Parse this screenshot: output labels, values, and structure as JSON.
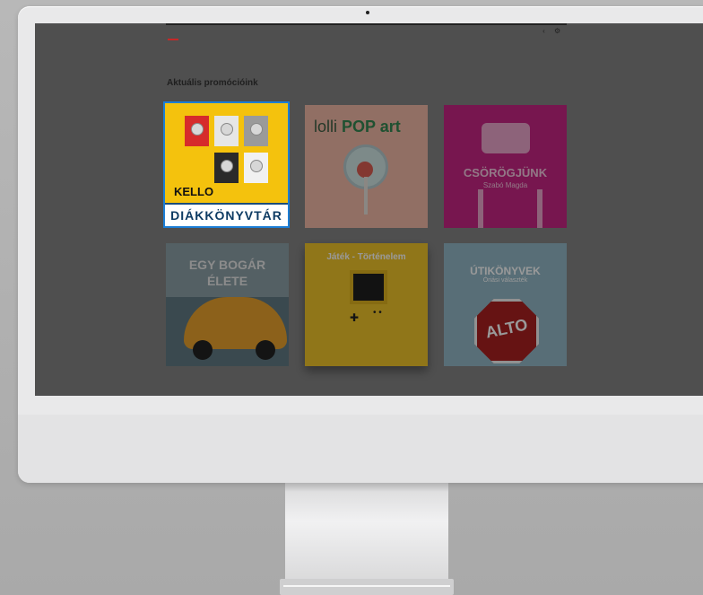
{
  "page": {
    "heading": "Aktuális promócióink"
  },
  "tiles": [
    {
      "title": "DIÁKKÖNYVTÁR",
      "brand": "KELLO"
    },
    {
      "title_plain": "lolli",
      "title_bold": "POP art"
    },
    {
      "title": "CSÖRÖGJÜNK",
      "subtitle": "Szabó Magda"
    },
    {
      "title_line1": "EGY BOGÁR",
      "title_line2": "ÉLETE"
    },
    {
      "title": "Játék - Történelem"
    },
    {
      "title": "ÚTIKÖNYVEK",
      "subtitle": "Óriási választék",
      "sign_text": "ALTO"
    }
  ],
  "icons": {
    "top_icon_1": "chevron-left-icon",
    "top_icon_2": "gear-icon"
  },
  "colors": {
    "accent_red": "#c62828",
    "selection_blue": "#1c7ed6"
  }
}
